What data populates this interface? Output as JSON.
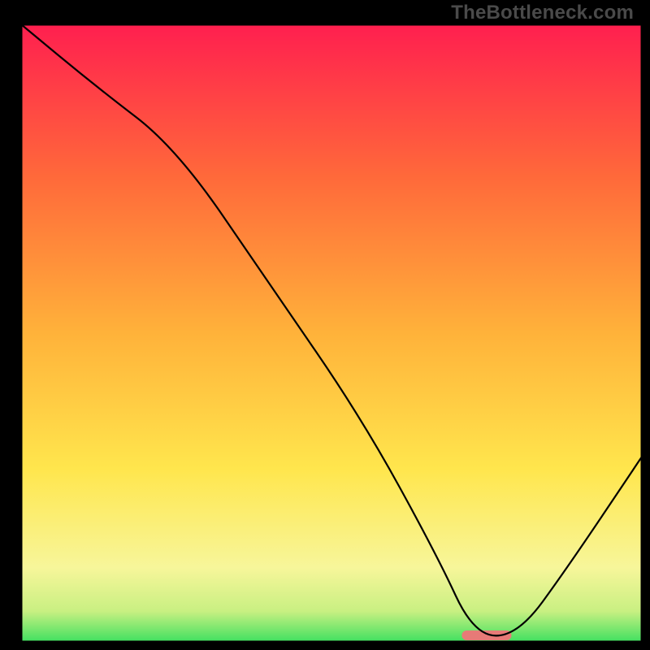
{
  "watermark": "TheBottleneck.com",
  "colors": {
    "border": "#000000",
    "curve": "#000000",
    "marker": "#e77a77",
    "gradient_stops": [
      {
        "pct": 0,
        "color": "#ff1f4f"
      },
      {
        "pct": 25,
        "color": "#ff6a3a"
      },
      {
        "pct": 50,
        "color": "#ffb23a"
      },
      {
        "pct": 72,
        "color": "#ffe64d"
      },
      {
        "pct": 88,
        "color": "#f7f69a"
      },
      {
        "pct": 95,
        "color": "#c9f082"
      },
      {
        "pct": 100,
        "color": "#40e060"
      }
    ]
  },
  "chart_data": {
    "type": "line",
    "title": "",
    "xlabel": "",
    "ylabel": "",
    "xlim": [
      0,
      100
    ],
    "ylim": [
      0,
      100
    ],
    "x": [
      0,
      12,
      25,
      40,
      55,
      67,
      73,
      80,
      88,
      100
    ],
    "values": [
      100,
      90,
      80,
      58,
      36,
      14,
      1,
      1,
      12,
      30
    ],
    "marker": {
      "x": 75,
      "y": 0,
      "width": 8
    }
  }
}
